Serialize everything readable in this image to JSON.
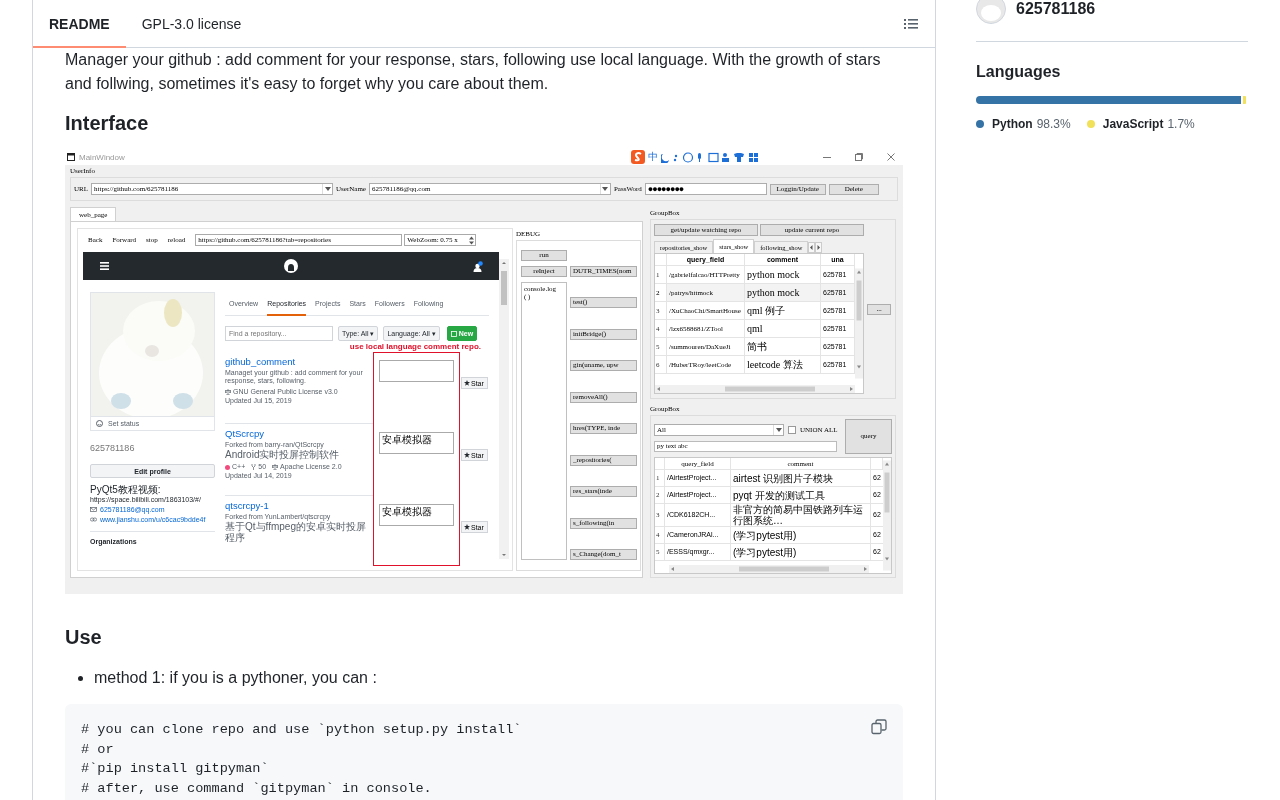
{
  "header": {
    "tabs": [
      {
        "label": "README",
        "selected": true
      },
      {
        "label": "GPL-3.0 license",
        "selected": false
      }
    ]
  },
  "readme": {
    "intro": "Manager your github : add comment for your response, stars, following use local language. With the growth of stars and follwing, sometimes it's easy to forget why you care about them.",
    "heading_1": "Interface",
    "app_window": {
      "title": "MainWindow",
      "ime_mode": "中",
      "userinfo": {
        "title": "UserInfo",
        "url_label": "URL",
        "url": "https://github.com/625781186",
        "user_label": "UserName",
        "user": "625781186@qq.com",
        "password_label": "PassWord",
        "password_mask": "●●●●●●●●",
        "buttons": [
          "Loggin/Update",
          "Delete"
        ]
      },
      "tabs": [
        {
          "label": "web_page",
          "selected": true
        }
      ],
      "browser": {
        "nav_buttons": [
          "Back",
          "Forward",
          "stop",
          "reload"
        ],
        "address": "https://github.com/625781186?tab=repositories",
        "zoom": "WebZoom: 0.75 x",
        "profile": {
          "set_status": "Set status",
          "login": "625781186",
          "edit_button": "Edit profile",
          "bio": "PyQt5教程视频:",
          "bio_link": "https://space.bilibili.com/1863103/#/",
          "email": "625781186@qq.com",
          "blog": "www.jianshu.com/u/c6cac9bdde4f",
          "organizations": "Organizations"
        },
        "profile_tabs": [
          {
            "label": "Overview",
            "selected": false
          },
          {
            "label": "Repositories",
            "selected": true
          },
          {
            "label": "Projects",
            "selected": false
          },
          {
            "label": "Stars",
            "selected": false
          },
          {
            "label": "Followers",
            "selected": false
          },
          {
            "label": "Following",
            "selected": false
          }
        ],
        "search": {
          "placeholder": "Find a repository..."
        },
        "filters": [
          "Type: All ▾",
          "Language: All ▾"
        ],
        "new_button": "New",
        "note": "use local language comment repo.",
        "repos": [
          {
            "name": "github_comment",
            "description": "Managet your github : add comment for your response, stars, following.",
            "meta": [
              {
                "kind": "license",
                "text": "GNU General Public License v3.0"
              },
              {
                "kind": "updated",
                "text": "Updated Jul 15, 2019"
              }
            ],
            "star": "Star"
          },
          {
            "name": "QtScrcpy",
            "fork_note": "Forked from barry-ran/QtScrcpy",
            "description": "Android实时投屏控制软件",
            "meta": [
              {
                "kind": "language",
                "text": "C++",
                "color": "#f34b7d"
              },
              {
                "kind": "forks",
                "text": "50"
              },
              {
                "kind": "license",
                "text": "Apache License 2.0"
              },
              {
                "kind": "updated",
                "text": "Updated Jul 14, 2019"
              }
            ],
            "comment": "安卓模拟器",
            "star": "Star"
          },
          {
            "name": "qtscrcpy-1",
            "fork_note": "Forked from YunLambert/qtscrcpy",
            "description": "基于Qt与ffmpeg的安卓实时投屏程序",
            "comment": "安卓模拟器",
            "star": "Star"
          }
        ]
      },
      "debug": {
        "title": "DEBUG",
        "left_buttons": [
          "run",
          "reInject"
        ],
        "console_lines": [
          "console.log",
          "( )"
        ],
        "right_buttons": [
          "DUTR_TIMES(nom",
          "test()",
          "initBridge()",
          "gin(uname, upw",
          "removeAll()",
          "hres(TYPE, inde",
          "_repositories(",
          "res_stars(inde",
          "s_following(in",
          "s_Change(dom_t"
        ]
      },
      "stars_group": {
        "title": "GroupBox",
        "buttons": [
          "get/update watching repo",
          "update current repo"
        ],
        "tabs": [
          {
            "label": "repositories_show",
            "selected": false
          },
          {
            "label": "stars_show",
            "selected": true
          },
          {
            "label": "following_show",
            "selected": false
          }
        ],
        "table": {
          "columns": [
            "query_field",
            "comment",
            "una"
          ],
          "rows": [
            {
              "index": "1",
              "selected": false,
              "cells": [
                "/gabrielfalcao/HTTPretty",
                "python mock",
                "625781"
              ]
            },
            {
              "index": "2",
              "selected": true,
              "cells": [
                "/patrys/httmock",
                "python mock",
                "625781"
              ]
            },
            {
              "index": "3",
              "selected": false,
              "cells": [
                "/XuChaoChi/SmartHouse",
                "qml 例子",
                "625781"
              ]
            },
            {
              "index": "4",
              "selected": false,
              "cells": [
                "/lzx6588681/ZTool",
                "qml",
                "625781"
              ]
            },
            {
              "index": "5",
              "selected": false,
              "cells": [
                "/summouren/DaXueJi",
                "简书",
                "625781"
              ]
            },
            {
              "index": "6",
              "selected": false,
              "cells": [
                "/HuberTRoy/leetCode",
                "leetcode 算法",
                "625781"
              ]
            }
          ]
        },
        "side_button": "..."
      },
      "query_group": {
        "title": "GroupBox",
        "combo": "All",
        "union": {
          "label": "UNION ALL",
          "checked": false
        },
        "query_button": "query",
        "filter_value": "py text abc",
        "table": {
          "columns": [
            "query_field",
            "comment"
          ],
          "rows": [
            {
              "index": "1",
              "cells": [
                "/AirtestProject...",
                "airtest 识别图片子模块",
                "62"
              ]
            },
            {
              "index": "2",
              "cells": [
                "/AirtestProject...",
                "pyqt 开发的测试工具",
                "62"
              ]
            },
            {
              "index": "3",
              "cells": [
                "/CDK6182CH...",
                "非官方的简易中国铁路列车运行图系统…",
                "62"
              ]
            },
            {
              "index": "4",
              "cells": [
                "/CameronJRAl...",
                "(学习pytest用)",
                "62"
              ]
            },
            {
              "index": "5",
              "cells": [
                "/ESSS/qmxgr...",
                "(学习pytest用)",
                "62"
              ]
            }
          ]
        }
      }
    },
    "heading_2": "Use",
    "bullets": [
      "method 1: if you is a pythoner, you can :"
    ],
    "code_lines": [
      "# you can clone repo and use `python setup.py install`",
      "# or",
      "#`pip install gitpyman`",
      "# after, use command `gitpyman` in console."
    ]
  },
  "sidebar": {
    "username": "625781186",
    "languages_title": "Languages",
    "languages": [
      {
        "name": "Python",
        "percent": "98.3%",
        "color": "#3572a5"
      },
      {
        "name": "JavaScript",
        "percent": "1.7%",
        "color": "#f1e05a"
      }
    ]
  }
}
